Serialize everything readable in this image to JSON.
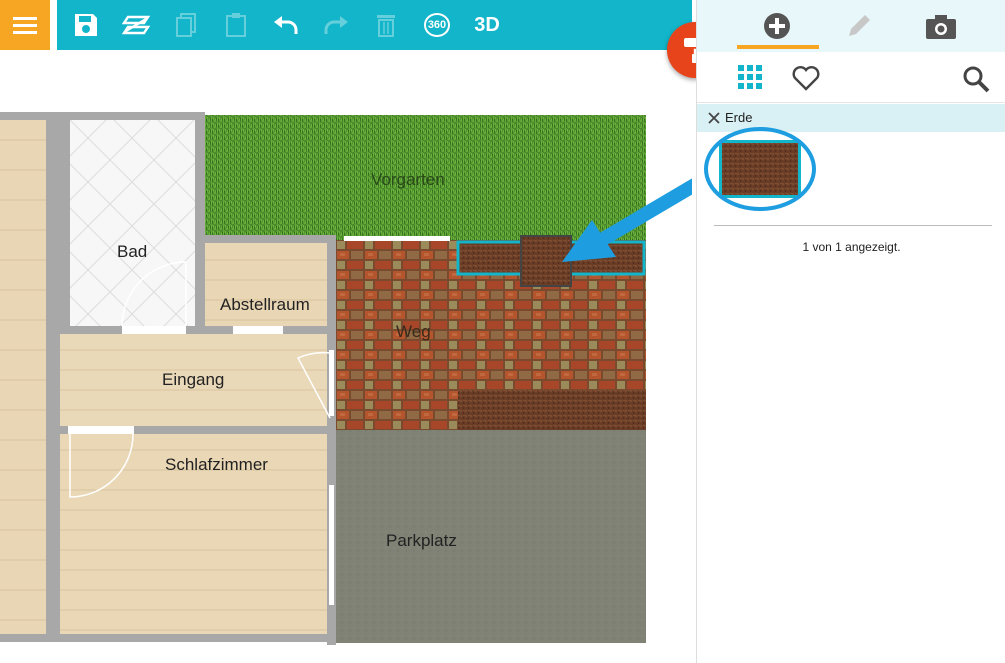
{
  "toolbar": {
    "menu": "menu-icon",
    "buttons": [
      {
        "name": "save-icon",
        "enabled": true
      },
      {
        "name": "layers-icon",
        "enabled": true
      },
      {
        "name": "copy-icon",
        "enabled": false
      },
      {
        "name": "paste-icon",
        "enabled": false
      },
      {
        "name": "undo-icon",
        "enabled": true
      },
      {
        "name": "redo-icon",
        "enabled": false
      },
      {
        "name": "delete-icon",
        "enabled": false
      },
      {
        "name": "360-view-icon",
        "label": "360",
        "enabled": true
      },
      {
        "name": "3d-view-button",
        "label": "3D",
        "enabled": true
      }
    ],
    "color": "#12b5c9",
    "menu_color": "#f6a623"
  },
  "paint_button": {
    "icon": "paint-roller-icon",
    "color": "#e8441c"
  },
  "panel": {
    "tabs": [
      "add-icon",
      "edit-icon",
      "camera-icon"
    ],
    "active_tab": "add-icon",
    "sub_tabs": [
      "grid-icon",
      "heart-icon",
      "search-icon"
    ],
    "filter": {
      "label": "Erde"
    },
    "results": [
      {
        "name": "Erde",
        "texture": "soil"
      }
    ],
    "result_text": "1 von 1 angezeigt."
  },
  "floorplan": {
    "rooms": {
      "bad": "Bad",
      "abstellraum": "Abstellraum",
      "eingang": "Eingang",
      "schlafzimmer": "Schlafzimmer",
      "vorgarten": "Vorgarten",
      "weg": "Weg",
      "parkplatz": "Parkplatz"
    }
  },
  "annotation": {
    "color": "#1e9ee0"
  }
}
